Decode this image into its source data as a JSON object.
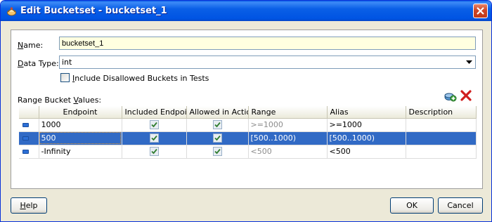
{
  "window": {
    "title": "Edit Bucketset - bucketset_1"
  },
  "form": {
    "name_label": "Name:",
    "name_value": "bucketset_1",
    "datatype_label": "Data Type:",
    "datatype_value": "int",
    "include_disallowed_label": "Include Disallowed Buckets in Tests",
    "include_disallowed_checked": false
  },
  "range": {
    "label": "Range Bucket Values:",
    "add_icon": "add-bucket-icon",
    "delete_icon": "delete-bucket-icon",
    "columns": [
      "Endpoint",
      "Included Endpoint",
      "Allowed in Actions",
      "Range",
      "Alias",
      "Description"
    ],
    "rows": [
      {
        "endpoint": "1000",
        "included": true,
        "allowed": true,
        "range": ">=1000",
        "alias": ">=1000",
        "description": ""
      },
      {
        "endpoint": "500",
        "included": true,
        "allowed": true,
        "range": "[500..1000)",
        "alias": "[500..1000)",
        "description": "",
        "selected": true
      },
      {
        "endpoint": "-Infinity",
        "included": true,
        "allowed": true,
        "range": "<500",
        "alias": "<500",
        "description": ""
      }
    ]
  },
  "buttons": {
    "help": "Help",
    "ok": "OK",
    "cancel": "Cancel"
  }
}
